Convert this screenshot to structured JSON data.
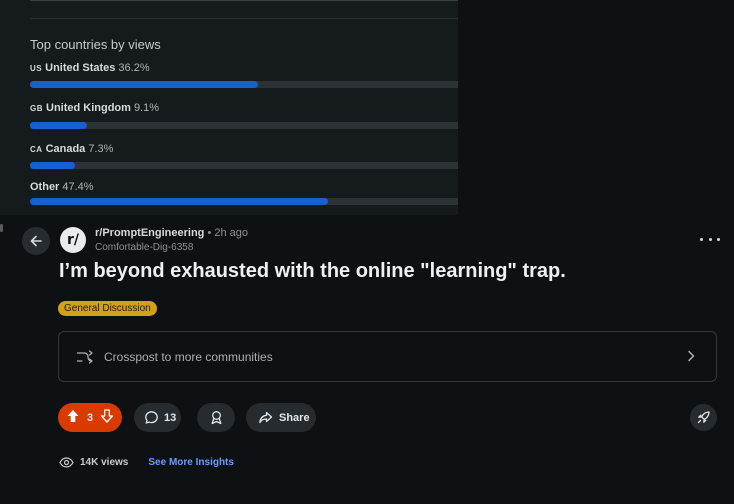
{
  "insights_panel": {
    "title": "Top countries by views",
    "countries": [
      {
        "code": "US",
        "name": "United States",
        "percent_text": "36.2%",
        "fraction": 0.53
      },
      {
        "code": "GB",
        "name": "United Kingdom",
        "percent_text": "9.1%",
        "fraction": 0.133
      },
      {
        "code": "CA",
        "name": "Canada",
        "percent_text": "7.3%",
        "fraction": 0.105
      },
      {
        "code": "",
        "name": "Other",
        "percent_text": "47.4%",
        "fraction": 0.693
      }
    ],
    "bar_color": "#1a5fd0"
  },
  "post": {
    "subreddit": "r/PromptEngineering",
    "separator": "•",
    "time_ago": "2h ago",
    "author": "Comfortable-Dig-6358",
    "avatar_glyph": "r/",
    "title": "I’m beyond exhausted with the online \"learning\" trap.",
    "flair": "General Discussion",
    "flair_color": "#d4a017",
    "crosspost_label": "Crosspost to more communities",
    "vote_count": "3",
    "vote_color": "#d93a00",
    "comment_count": "13",
    "share_label": "Share",
    "views": "14K views",
    "insights_link": "See More Insights"
  },
  "icons": [
    "back-arrow-icon",
    "more-options-icon",
    "crosspost-icon",
    "chevron-right-icon",
    "upvote-icon",
    "downvote-icon",
    "comment-icon",
    "award-icon",
    "share-icon",
    "rocket-icon",
    "eye-icon"
  ]
}
